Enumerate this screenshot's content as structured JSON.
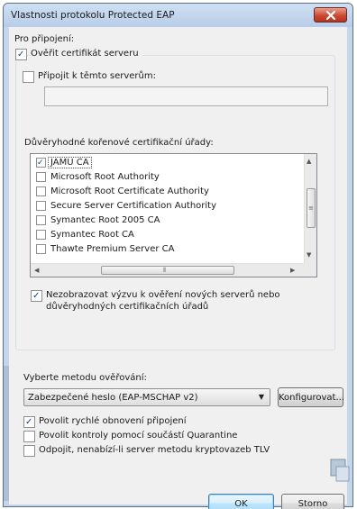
{
  "window": {
    "title": "Vlastnosti protokolu Protected EAP",
    "close_icon": "close-icon"
  },
  "connect_label": "Pro připojení:",
  "verify_cert": {
    "label": "Ověřit certifikát serveru",
    "checked": true
  },
  "connect_servers": {
    "label": "Připojit k těmto serverům:",
    "checked": false,
    "value": ""
  },
  "trusted_ca": {
    "label": "Důvěryhodné kořenové certifikační úřady:",
    "items": [
      {
        "label": "JAMU CA",
        "checked": true
      },
      {
        "label": "Microsoft Root Authority",
        "checked": false
      },
      {
        "label": "Microsoft Root Certificate Authority",
        "checked": false
      },
      {
        "label": "Secure Server Certification Authority",
        "checked": false
      },
      {
        "label": "Symantec Root 2005 CA",
        "checked": false
      },
      {
        "label": "Symantec Root CA",
        "checked": false
      },
      {
        "label": "Thawte Premium Server CA",
        "checked": false
      }
    ]
  },
  "no_prompt": {
    "line1": "Nezobrazovat výzvu k ověření nových serverů nebo",
    "line2": "důvěryhodných certifikačních úřadů",
    "checked": true
  },
  "method": {
    "label": "Vyberte metodu ověřování:",
    "selected": "Zabezpečené heslo (EAP-MSCHAP v2)",
    "configure_label": "Konfigurovat..."
  },
  "fast_reconnect": {
    "label": "Povolit rychlé obnovení připojení",
    "checked": true
  },
  "quarantine": {
    "label": "Povolit kontroly pomocí součástí Quarantine",
    "checked": false
  },
  "disconnect_tlv": {
    "label": "Odpojit, nenabízí-li server metodu kryptovazeb TLV",
    "checked": false
  },
  "buttons": {
    "ok": "OK",
    "cancel": "Storno"
  },
  "colors": {
    "accent": "#3c7fb1",
    "close": "#cc4a33",
    "frame": "#c3d6ec"
  }
}
